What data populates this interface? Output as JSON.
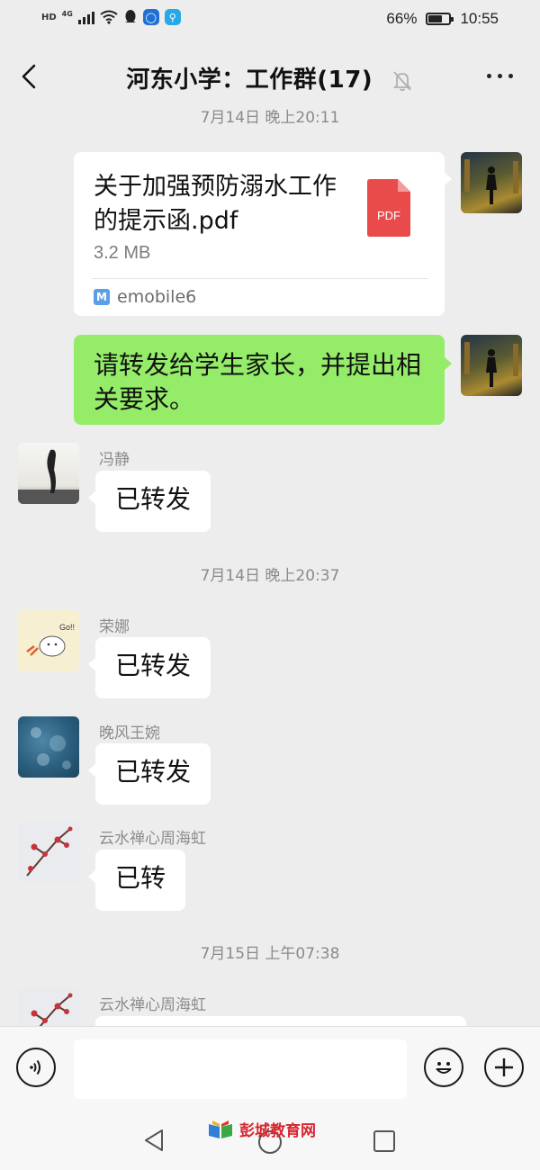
{
  "status_bar": {
    "network_hd": "HD",
    "network_gen": "4G",
    "battery": "66%",
    "battery_level": 0.66,
    "time": "10:55"
  },
  "header": {
    "title": "河东小学：工作群(17)"
  },
  "messages": {
    "time1": "7月14日 晚上20:11",
    "file": {
      "name": "关于加强预防溺水工作的提示函.pdf",
      "size": "3.2 MB",
      "type_label": "PDF",
      "source": "emobile6"
    },
    "outgoing_text": "请转发给学生家长，并提出相关要求。",
    "reply1": {
      "sender": "冯静",
      "text": "已转发"
    },
    "time2": "7月14日 晚上20:37",
    "reply2": {
      "sender": "荣娜",
      "text": "已转发",
      "avatar_caption": "Go!!"
    },
    "reply3": {
      "sender": "晚风王婉",
      "text": "已转发"
    },
    "reply4": {
      "sender": "云水禅心周海虹",
      "text": "已转"
    },
    "time3": "7月15日 上午07:38",
    "reply5": {
      "sender": "云水禅心周海虹"
    }
  },
  "watermark": "彭城教育网",
  "icons": {
    "back": "chevron-left-icon",
    "mute": "bell-off-icon",
    "more": "more-dots-icon",
    "voice": "voice-icon",
    "emoji": "emoji-icon",
    "add": "plus-icon"
  },
  "colors": {
    "background": "#ededed",
    "outgoing_bubble": "#95ec69",
    "incoming_bubble": "#ffffff",
    "pdf_icon": "#e94b4b"
  }
}
